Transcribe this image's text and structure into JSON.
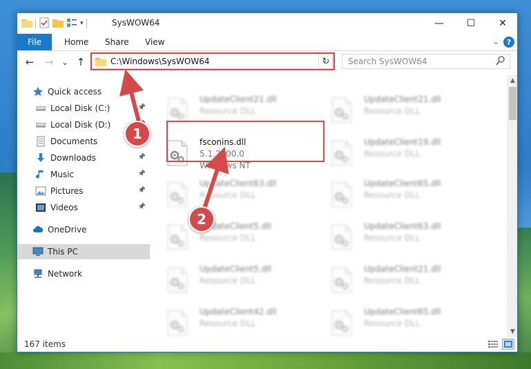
{
  "window": {
    "title": "SysWOW64",
    "controls": {
      "minimize": "—",
      "maximize": "☐",
      "close": "✕"
    }
  },
  "ribbon": {
    "tabs": [
      "File",
      "Home",
      "Share",
      "View"
    ],
    "help": "?"
  },
  "navigation": {
    "back": "←",
    "forward": "→",
    "recent": "⌄",
    "up": "↑",
    "address": "C:\\Windows\\SysWOW64",
    "search_placeholder": "Search SysWOW64"
  },
  "sidebar": {
    "items": [
      {
        "label": "Quick access",
        "icon": "star-icon",
        "pinned": false
      },
      {
        "label": "Local Disk (C:)",
        "icon": "drive-icon",
        "pinned": true
      },
      {
        "label": "Local Disk (D:)",
        "icon": "drive-icon",
        "pinned": true
      },
      {
        "label": "Documents",
        "icon": "documents-icon",
        "pinned": true
      },
      {
        "label": "Downloads",
        "icon": "download-icon",
        "pinned": true
      },
      {
        "label": "Music",
        "icon": "music-icon",
        "pinned": true
      },
      {
        "label": "Pictures",
        "icon": "pictures-icon",
        "pinned": true
      },
      {
        "label": "Videos",
        "icon": "videos-icon",
        "pinned": true
      },
      {
        "label": "OneDrive",
        "icon": "cloud-icon",
        "pinned": false
      },
      {
        "label": "This PC",
        "icon": "computer-icon",
        "pinned": false,
        "selected": true
      },
      {
        "label": "Network",
        "icon": "network-icon",
        "pinned": false
      }
    ]
  },
  "files": {
    "featured": {
      "name": "fsconins.dll",
      "version": "5.1.2600.0",
      "company": "Windows NT"
    },
    "left": [
      {
        "name": "UpdateClient21.dll",
        "type": "Resource DLL"
      },
      {
        "name": "UpdateClient63.dll",
        "type": "Resource DLL"
      },
      {
        "name": "UpdateClient5.dll",
        "type": "Resource DLL"
      },
      {
        "name": "UpdateClient5.dll",
        "type": "Resource DLL"
      },
      {
        "name": "UpdateClient42.dll",
        "type": "Resource DLL"
      }
    ],
    "right": [
      {
        "name": "UpdateClient21.dll",
        "type": "Resource DLL"
      },
      {
        "name": "UpdateClient19.dll",
        "type": "Resource DLL"
      },
      {
        "name": "UpdateClient65.dll",
        "type": "Resource DLL"
      },
      {
        "name": "UpdateClient63.dll",
        "type": "Resource DLL"
      },
      {
        "name": "UpdateClient21.dll",
        "type": "Resource DLL"
      },
      {
        "name": "UpdateClient65.dll",
        "type": "Resource DLL"
      }
    ]
  },
  "status": {
    "count": "167 items"
  },
  "callouts": [
    "1",
    "2"
  ],
  "colors": {
    "accent": "#1979ca",
    "highlight": "#d44a4a"
  }
}
